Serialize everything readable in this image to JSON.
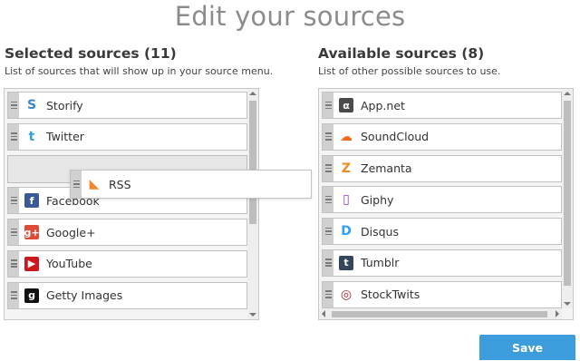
{
  "title": "Edit your sources",
  "selected": {
    "heading": "Selected sources (11)",
    "subtitle": "List of sources that will show up in your source menu.",
    "items": [
      {
        "label": "Storify",
        "icon": "storify-icon",
        "color": "#3a87c9"
      },
      {
        "label": "Twitter",
        "icon": "twitter-icon",
        "color": "#2aa3ef"
      },
      {
        "label": "",
        "icon": "",
        "color": "",
        "placeholder": true
      },
      {
        "label": "Facebook",
        "icon": "facebook-icon",
        "color": "#3b5998"
      },
      {
        "label": "Google+",
        "icon": "google-plus-icon",
        "color": "#dd4b39"
      },
      {
        "label": "YouTube",
        "icon": "youtube-icon",
        "color": "#cc181e"
      },
      {
        "label": "Getty Images",
        "icon": "getty-images-icon",
        "color": "#111111"
      }
    ]
  },
  "available": {
    "heading": "Available sources (8)",
    "subtitle": "List of other possible sources to use.",
    "items": [
      {
        "label": "App.net",
        "icon": "app-net-icon",
        "color": "#4a4a4a"
      },
      {
        "label": "SoundCloud",
        "icon": "soundcloud-icon",
        "color": "#f26b1d"
      },
      {
        "label": "Zemanta",
        "icon": "zemanta-icon",
        "color": "#f28b22"
      },
      {
        "label": "Giphy",
        "icon": "giphy-icon",
        "color": "#8a3fd1"
      },
      {
        "label": "Disqus",
        "icon": "disqus-icon",
        "color": "#2e9fff"
      },
      {
        "label": "Tumblr",
        "icon": "tumblr-icon",
        "color": "#35465c"
      },
      {
        "label": "StockTwits",
        "icon": "stocktwits-icon",
        "color": "#b5262e"
      }
    ]
  },
  "dragging": {
    "label": "RSS",
    "icon": "rss-icon",
    "color": "#f0892e"
  },
  "save_label": "Save",
  "colors": {
    "accent": "#3d9ddc",
    "title": "#8c8c8c"
  }
}
